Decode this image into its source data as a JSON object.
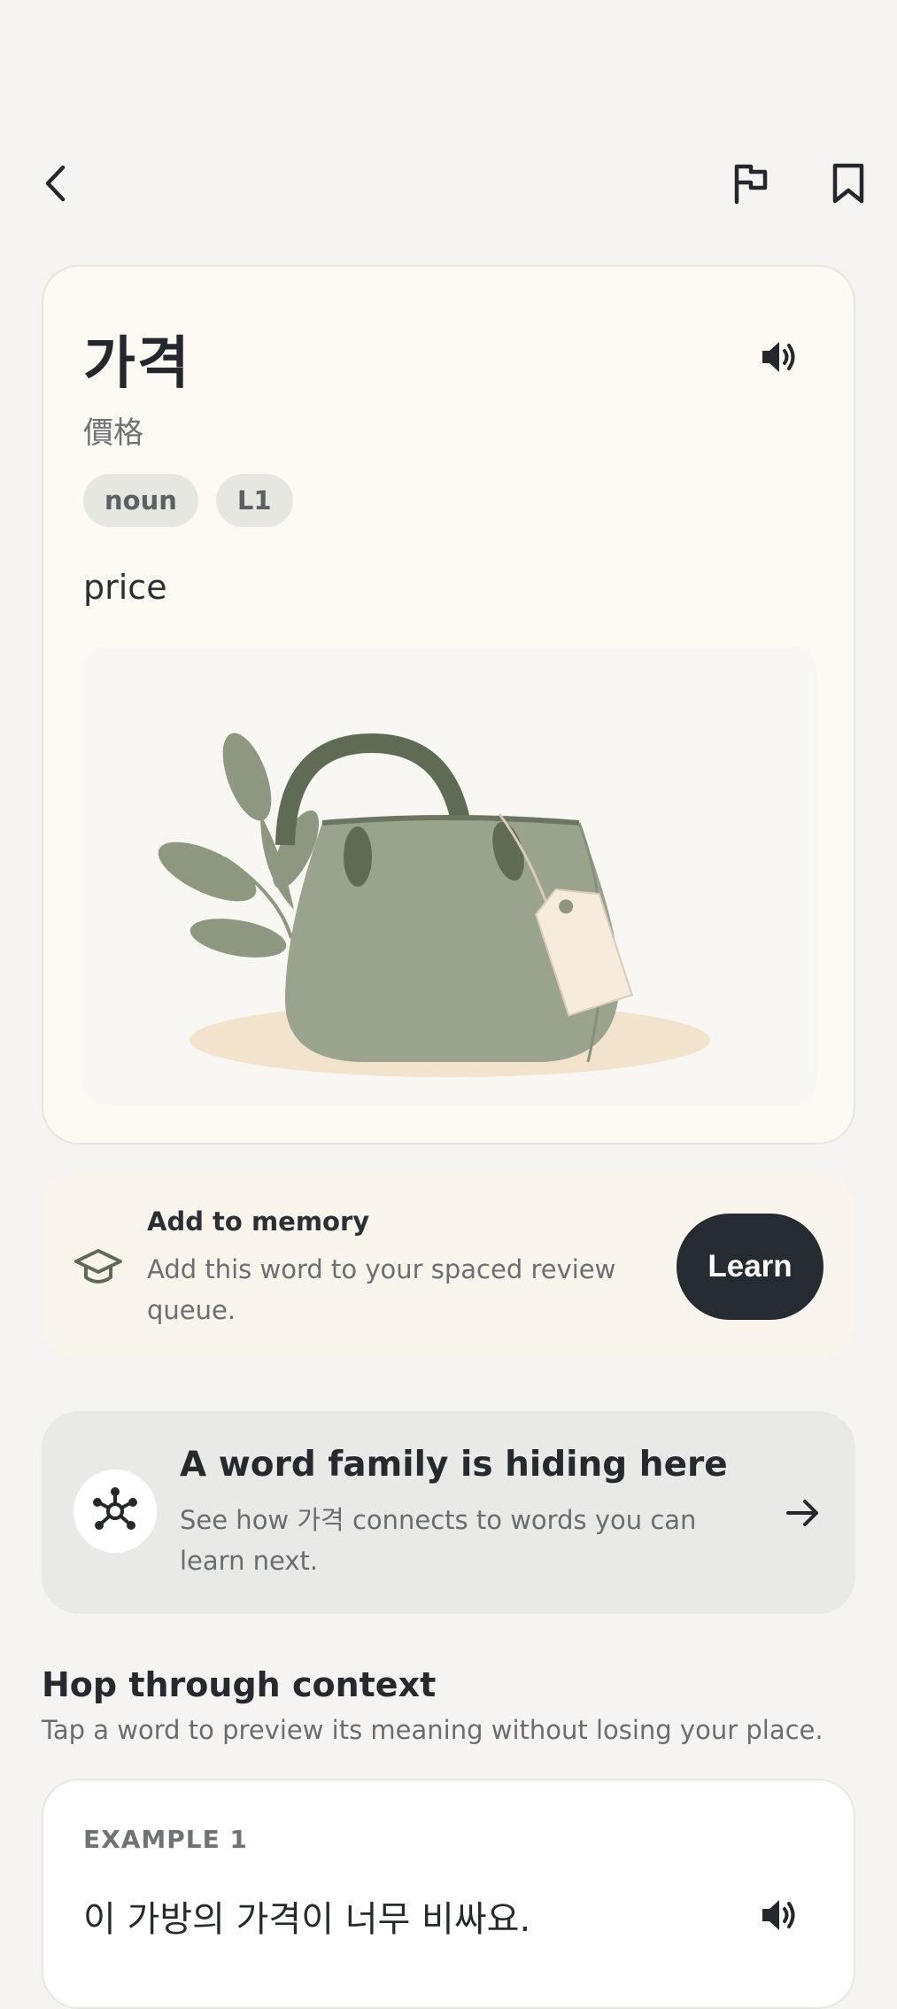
{
  "word": {
    "title": "가격",
    "hanja": "價格",
    "tags": [
      "noun",
      "L1"
    ],
    "meaning": "price",
    "illustration_icon": "handbag-with-price-tag-illustration"
  },
  "memory": {
    "title": "Add to memory",
    "description": "Add this word to your spaced review queue.",
    "button_label": "Learn",
    "icon": "graduation-cap-icon"
  },
  "family": {
    "title": "A word family is hiding here",
    "description": "See how 가격 connects to words you can learn next.",
    "icon": "network-icon"
  },
  "context": {
    "title": "Hop through context",
    "subtitle": "Tap a word to preview its meaning without losing your place.",
    "examples": [
      {
        "label": "EXAMPLE 1",
        "sentence": "이 가방의 가격이 너무 비싸요."
      }
    ]
  },
  "colors": {
    "background": "#f5f4f2",
    "card": "#fdfaf3",
    "accent_dark": "#262b31",
    "bag_green": "#9aa38e"
  }
}
